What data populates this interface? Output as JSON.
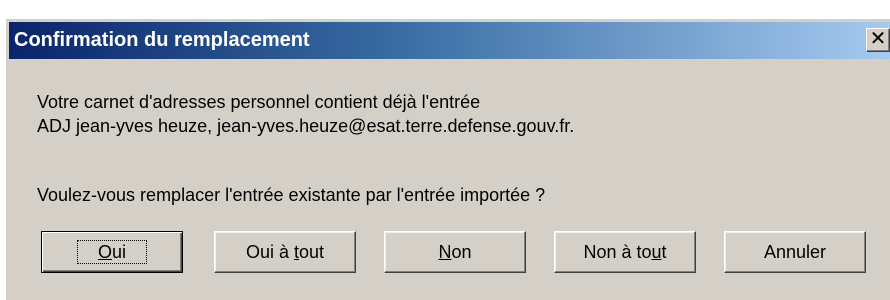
{
  "dialog": {
    "title": "Confirmation du remplacement",
    "close_glyph": "✕",
    "close_icon": "close-icon",
    "message_line1": "Votre carnet d'adresses personnel contient déjà l'entrée",
    "message_line2": "ADJ jean-yves heuze, jean-yves.heuze@esat.terre.defense.gouv.fr.",
    "question": "Voulez-vous remplacer l'entrée existante par l'entrée importée ?"
  },
  "buttons": {
    "oui": {
      "pre": "",
      "key": "O",
      "post": "ui"
    },
    "oui_tout": {
      "pre": "Oui à ",
      "key": "t",
      "post": "out"
    },
    "non": {
      "pre": "",
      "key": "N",
      "post": "on"
    },
    "non_tout": {
      "pre": "Non à to",
      "key": "u",
      "post": "t"
    },
    "annuler": {
      "pre": "Annuler",
      "key": "",
      "post": ""
    }
  },
  "colors": {
    "title_gradient_start": "#0a246a",
    "title_gradient_end": "#a6caf0",
    "face": "#d4d0c8"
  }
}
